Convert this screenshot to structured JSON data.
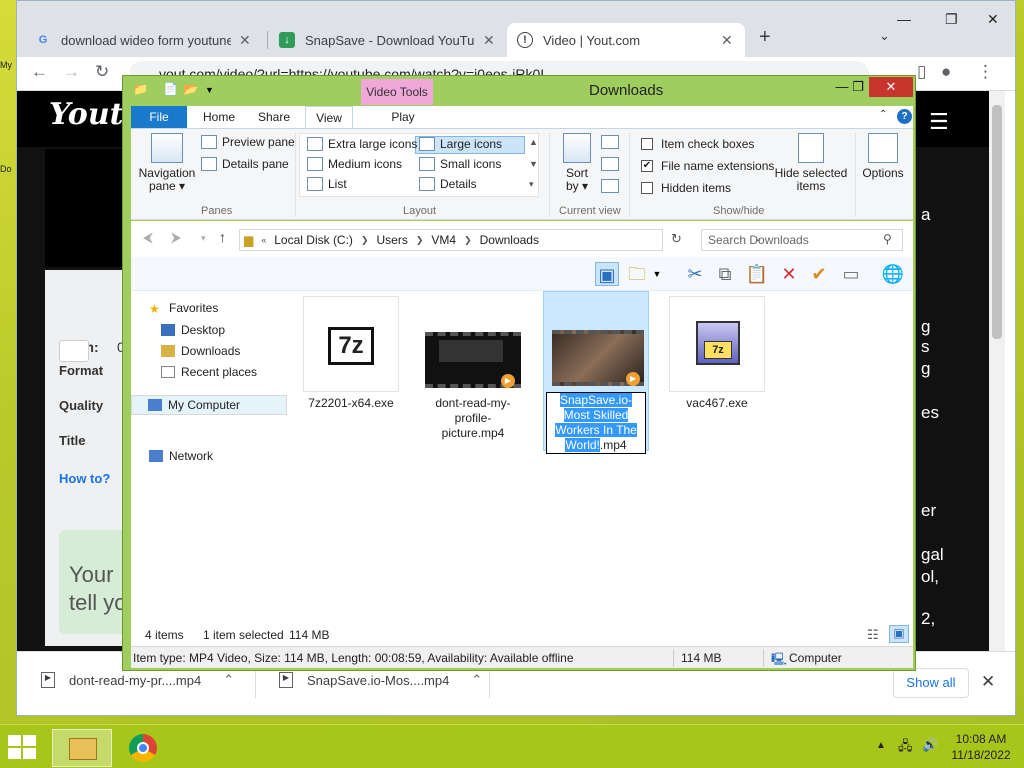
{
  "desktop": {
    "icons": [
      "My",
      "Do"
    ]
  },
  "browser": {
    "tabs": [
      {
        "title": "download wideo form youtune -",
        "icon": "google-icon",
        "active": false
      },
      {
        "title": "SnapSave - Download YouTube V",
        "icon": "snapsave-icon",
        "active": false
      },
      {
        "title": "Video | Yout.com",
        "icon": "yout-icon",
        "active": true
      }
    ],
    "url": "yout.com/video/?url=https://youtube.com/watch?v=i0eos-iRk0I",
    "page": {
      "logo": "Yout",
      "from_label": "From:",
      "from_value": "0",
      "labels": {
        "format": "Format",
        "quality": "Quality",
        "title": "Title",
        "howto": "How to?"
      },
      "note_line1": "Your",
      "note_line2": "tell yo",
      "right_fragments": [
        "a",
        "g",
        "s",
        "g",
        "es",
        "er",
        "gal",
        "ol,",
        "2,"
      ]
    },
    "downloads": [
      {
        "name": "dont-read-my-pr....mp4"
      },
      {
        "name": "SnapSave.io-Mos....mp4"
      }
    ],
    "show_all": "Show all"
  },
  "explorer": {
    "title": "Downloads",
    "contextual_tab": "Video Tools",
    "tabs": [
      "File",
      "Home",
      "Share",
      "View",
      "Play"
    ],
    "ribbon": {
      "panes": {
        "navigation": "Navigation pane",
        "preview": "Preview pane",
        "details": "Details pane",
        "group": "Panes"
      },
      "layout": {
        "group": "Layout",
        "options": [
          "Extra large icons",
          "Large icons",
          "Medium icons",
          "Small icons",
          "List",
          "Details"
        ],
        "selected": "Large icons"
      },
      "current_view": {
        "sort": "Sort by",
        "group": "Current view"
      },
      "show_hide": {
        "group": "Show/hide",
        "item_check_boxes": {
          "label": "Item check boxes",
          "checked": false
        },
        "file_name_extensions": {
          "label": "File name extensions",
          "checked": true
        },
        "hidden_items": {
          "label": "Hidden items",
          "checked": false
        },
        "hide_selected": "Hide selected items"
      },
      "options": "Options"
    },
    "address": {
      "crumbs": [
        "Local Disk (C:)",
        "Users",
        "VM4",
        "Downloads"
      ],
      "search_placeholder": "Search Downloads"
    },
    "nav": {
      "favorites": "Favorites",
      "items": [
        "Desktop",
        "Downloads",
        "Recent places"
      ],
      "computer": "My Computer",
      "network": "Network"
    },
    "files": [
      {
        "name": "7z2201-x64.exe",
        "type": "exe-7z"
      },
      {
        "name": "dont-read-my-profile-picture.mp4",
        "type": "video"
      },
      {
        "name_highlight": "SnapSave.io-Most Skilled Workers In The World!",
        "name_ext": ".mp4",
        "type": "video",
        "selected": true
      },
      {
        "name": "vac467.exe",
        "type": "exe-installer"
      }
    ],
    "status": {
      "items": "4 items",
      "selection": "1 item selected",
      "size": "114 MB"
    },
    "details_bar": {
      "text": "Item type: MP4 Video, Size: 114 MB, Length: 00:08:59, Availability: Available offline",
      "size": "114 MB",
      "location": "Computer"
    }
  },
  "taskbar": {
    "time": "10:08 AM",
    "date": "11/18/2022"
  }
}
